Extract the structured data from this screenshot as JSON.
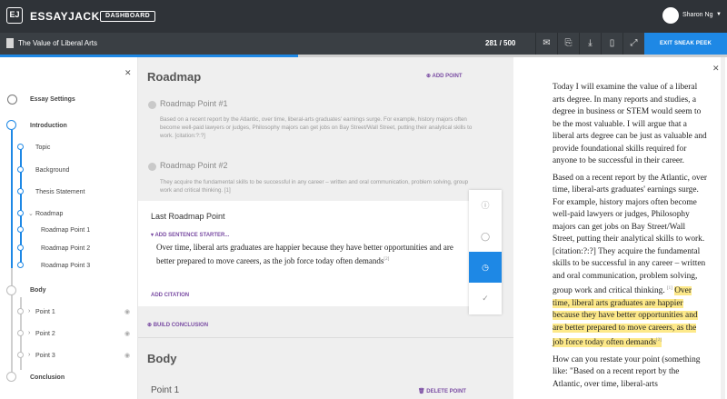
{
  "topbar": {
    "logo_text": "EJ",
    "brand": "ESSAYJACK",
    "dashboard_label": "DASHBOARD",
    "user_name": "Sharon Ng"
  },
  "docbar": {
    "title": "The Value of Liberal Arts",
    "word_count": "281 / 500",
    "progress_fraction": 0.41,
    "tools": [
      "mail-icon",
      "export-icon",
      "download-icon",
      "document-icon",
      "expand-icon"
    ],
    "exit_label": "EXIT SNEAK PEEK"
  },
  "sidebar": {
    "settings_label": "Essay Settings",
    "items": [
      {
        "label": "Introduction",
        "level": 0,
        "bold": true,
        "state": "done"
      },
      {
        "label": "Topic",
        "level": 1,
        "state": "done"
      },
      {
        "label": "Background",
        "level": 1,
        "state": "done"
      },
      {
        "label": "Thesis Statement",
        "level": 1,
        "state": "done"
      },
      {
        "label": "Roadmap",
        "level": 1,
        "state": "done",
        "expanded": true
      },
      {
        "label": "Roadmap Point 1",
        "level": 2,
        "state": "done"
      },
      {
        "label": "Roadmap Point 2",
        "level": 2,
        "state": "done"
      },
      {
        "label": "Roadmap Point 3",
        "level": 2,
        "state": "done"
      },
      {
        "label": "Body",
        "level": 0,
        "bold": true,
        "state": "todo"
      },
      {
        "label": "Point 1",
        "level": 1,
        "state": "todo",
        "collapsed": true
      },
      {
        "label": "Point 2",
        "level": 1,
        "state": "todo",
        "collapsed": true
      },
      {
        "label": "Point 3",
        "level": 1,
        "state": "todo",
        "collapsed": true
      },
      {
        "label": "Conclusion",
        "level": 0,
        "bold": true,
        "state": "todo"
      }
    ]
  },
  "middle": {
    "roadmap_title": "Roadmap",
    "add_point": "ADD POINT",
    "rp1_title": "Roadmap Point #1",
    "rp1_text": "Based on a recent report by the Atlantic, over time, liberal-arts graduates' earnings surge. For example, history majors often become well-paid lawyers or judges, Philosophy majors can get jobs on Bay Street/Wall Street, putting their analytical skills to work. [citation:?:?]",
    "rp2_title": "Roadmap Point #2",
    "rp2_text": "They acquire the fundamental skills to be successful in any career – written and oral communication, problem solving, group work and critical thinking. [1]",
    "last_title": "Last Roadmap Point",
    "add_sentence": "ADD SENTENCE STARTER...",
    "last_text": "Over time, liberal arts graduates are happier because they have better opportunities and are better prepared to move careers, as the job force today often demands",
    "last_cite": "[2]",
    "add_citation": "ADD CITATION",
    "build_conclusion": "BUILD CONCLUSION",
    "body_title": "Body",
    "point1_title": "Point 1",
    "delete_point": "DELETE POINT"
  },
  "tools": [
    "help-icon",
    "comment-icon",
    "clock-icon",
    "check-icon"
  ],
  "essay": {
    "p1": "Today I will examine the value of a liberal arts degree. In many reports and studies, a degree in business or STEM would seem to be the most valuable. I will argue that a liberal arts degree can be just as valuable and provide foundational skills required for anyone to be successful in their career.",
    "p2_a": "Based on a recent report by the Atlantic, over time, liberal-arts graduates' earnings surge. For example, history majors often become well-paid lawyers or judges, Philosophy majors can get jobs on Bay Street/Wall Street, putting their analytical skills to work. [citation:?:?] They acquire the fundamental skills to be successful in any career – written and oral communication, problem solving, group work and critical thinking.",
    "p2_cite": "[1]",
    "p2_hl": "Over time, liberal arts graduates are happier because they have better opportunities and are better prepared to move careers, as the job force today often demands",
    "p2_hl_cite": "[2]",
    "p3": "How can you restate your point (something like: \"Based on a recent report by the Atlantic, over time, liberal-arts"
  },
  "colors": {
    "accent": "#1e88e5",
    "link": "#7a4ca3",
    "highlight": "#fde98a",
    "topbar": "#2f3338"
  }
}
